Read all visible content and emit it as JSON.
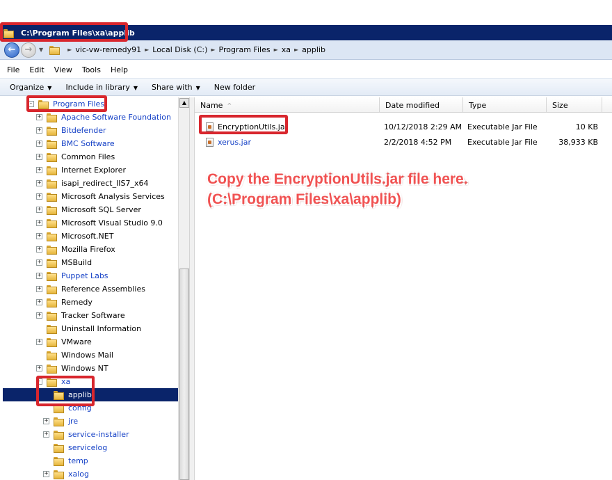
{
  "window": {
    "title": "C:\\Program Files\\xa\\applib"
  },
  "address": {
    "breadcrumbs": [
      "vic-vw-remedy91",
      "Local Disk (C:)",
      "Program Files",
      "xa",
      "applib"
    ]
  },
  "menu": [
    "File",
    "Edit",
    "View",
    "Tools",
    "Help"
  ],
  "toolbar": {
    "organize": "Organize",
    "include_in_library": "Include in library",
    "share_with": "Share with",
    "new_folder": "New folder"
  },
  "tree": {
    "items": [
      {
        "label": "Program Files",
        "level": 0,
        "expander": "−",
        "link": true
      },
      {
        "label": "Apache Software Foundation",
        "level": 1,
        "expander": "+",
        "link": true
      },
      {
        "label": "Bitdefender",
        "level": 1,
        "expander": "+",
        "link": true
      },
      {
        "label": "BMC Software",
        "level": 1,
        "expander": "+",
        "link": true
      },
      {
        "label": "Common Files",
        "level": 1,
        "expander": "+",
        "link": false
      },
      {
        "label": "Internet Explorer",
        "level": 1,
        "expander": "+",
        "link": false
      },
      {
        "label": "isapi_redirect_IIS7_x64",
        "level": 1,
        "expander": "+",
        "link": false
      },
      {
        "label": "Microsoft Analysis Services",
        "level": 1,
        "expander": "+",
        "link": false
      },
      {
        "label": "Microsoft SQL Server",
        "level": 1,
        "expander": "+",
        "link": false
      },
      {
        "label": "Microsoft Visual Studio 9.0",
        "level": 1,
        "expander": "+",
        "link": false
      },
      {
        "label": "Microsoft.NET",
        "level": 1,
        "expander": "+",
        "link": false
      },
      {
        "label": "Mozilla Firefox",
        "level": 1,
        "expander": "+",
        "link": false
      },
      {
        "label": "MSBuild",
        "level": 1,
        "expander": "+",
        "link": false
      },
      {
        "label": "Puppet Labs",
        "level": 1,
        "expander": "+",
        "link": true
      },
      {
        "label": "Reference Assemblies",
        "level": 1,
        "expander": "+",
        "link": false
      },
      {
        "label": "Remedy",
        "level": 1,
        "expander": "+",
        "link": false
      },
      {
        "label": "Tracker Software",
        "level": 1,
        "expander": "+",
        "link": false
      },
      {
        "label": "Uninstall Information",
        "level": 1,
        "expander": "",
        "link": false
      },
      {
        "label": "VMware",
        "level": 1,
        "expander": "+",
        "link": false
      },
      {
        "label": "Windows Mail",
        "level": 1,
        "expander": "",
        "link": false
      },
      {
        "label": "Windows NT",
        "level": 1,
        "expander": "+",
        "link": false
      },
      {
        "label": "xa",
        "level": 1,
        "expander": "−",
        "link": true
      },
      {
        "label": "applib",
        "level": 2,
        "expander": "",
        "link": true,
        "selected": true
      },
      {
        "label": "config",
        "level": 2,
        "expander": "",
        "link": true
      },
      {
        "label": "jre",
        "level": 2,
        "expander": "+",
        "link": true
      },
      {
        "label": "service-installer",
        "level": 2,
        "expander": "+",
        "link": true
      },
      {
        "label": "servicelog",
        "level": 2,
        "expander": "",
        "link": true
      },
      {
        "label": "temp",
        "level": 2,
        "expander": "",
        "link": true
      },
      {
        "label": "xalog",
        "level": 2,
        "expander": "+",
        "link": true
      }
    ]
  },
  "list": {
    "columns": [
      "Name",
      "Date modified",
      "Type",
      "Size"
    ],
    "sort_indicator": "^",
    "rows": [
      {
        "name": "EncryptionUtils.jar",
        "date": "10/12/2018 2:29 AM",
        "type": "Executable Jar File",
        "size": "10 KB",
        "link": false
      },
      {
        "name": "xerus.jar",
        "date": "2/2/2018 4:52 PM",
        "type": "Executable Jar File",
        "size": "38,933 KB",
        "link": true
      }
    ]
  },
  "annotation": {
    "line1": "Copy the EncryptionUtils.jar file here.",
    "line2": "(C:\\Program Files\\xa\\applib)",
    "color": "#f15252",
    "box_color": "#d8262d"
  },
  "colors": {
    "titlebar": "#0a246a",
    "selection": "#0a246a",
    "link": "#1440c6",
    "address_bg": "#dce6f4"
  }
}
